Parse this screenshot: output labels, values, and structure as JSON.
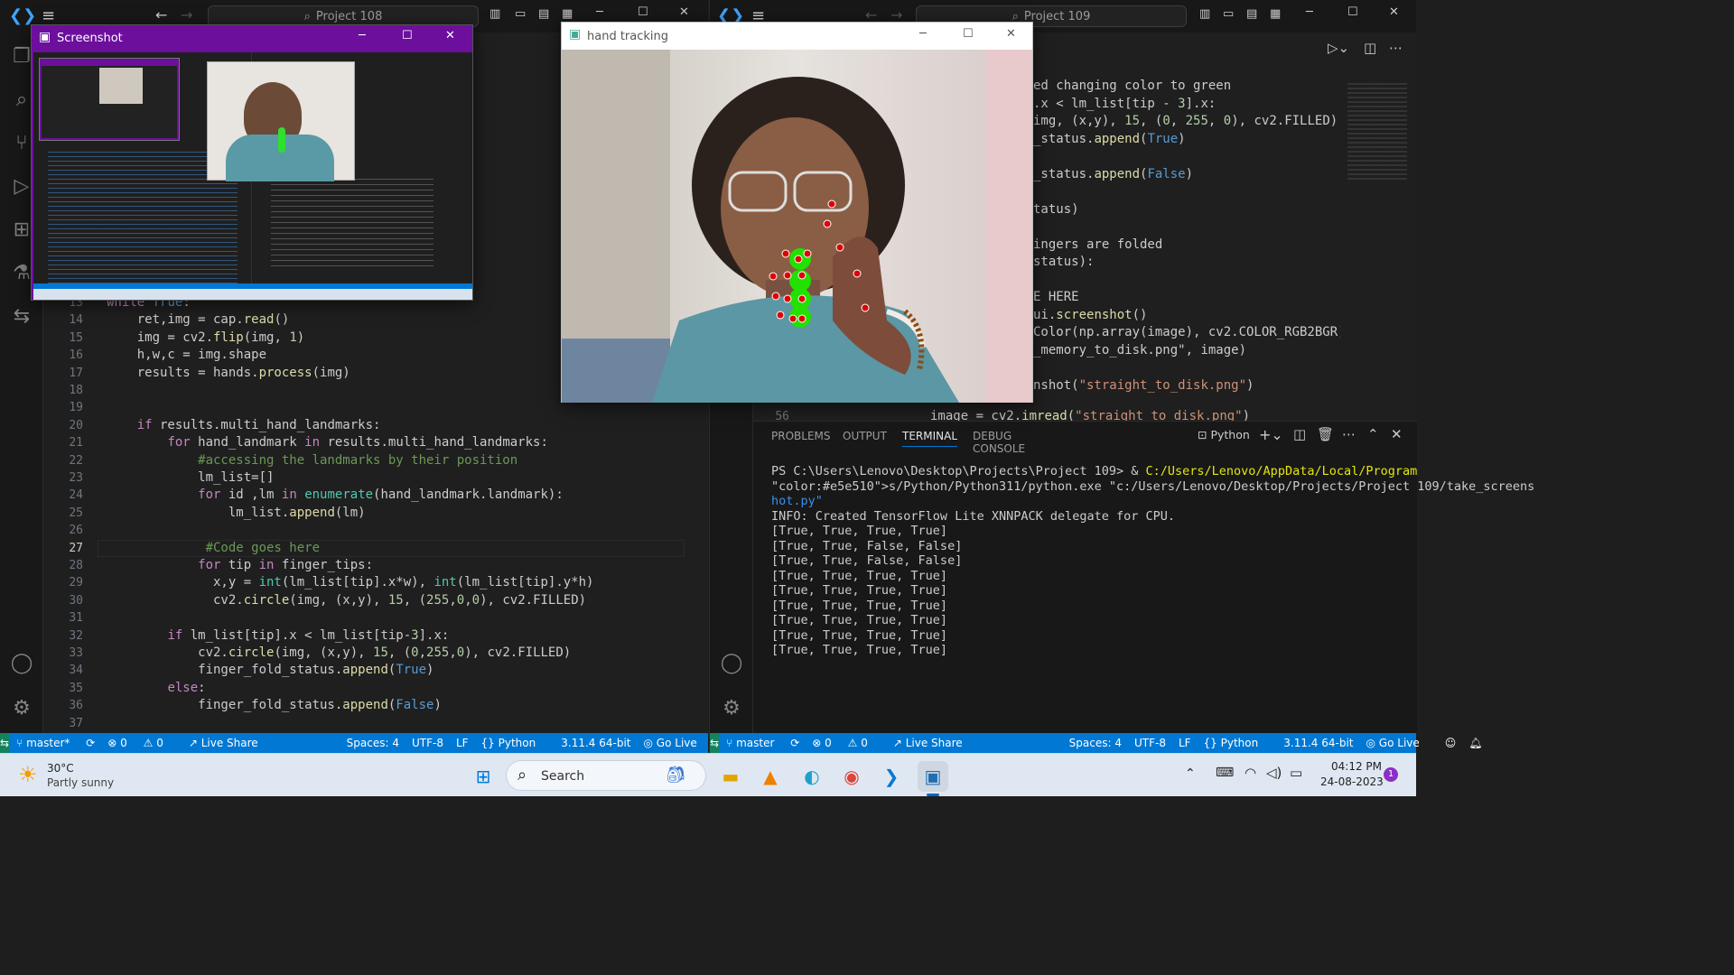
{
  "left_window": {
    "command_center": "Project 108",
    "code_lines": [
      {
        "n": "13",
        "t": "while True:"
      },
      {
        "n": "14",
        "t": "    ret,img = cap.read()"
      },
      {
        "n": "15",
        "t": "    img = cv2.flip(img, 1)"
      },
      {
        "n": "16",
        "t": "    h,w,c = img.shape"
      },
      {
        "n": "17",
        "t": "    results = hands.process(img)"
      },
      {
        "n": "18",
        "t": ""
      },
      {
        "n": "19",
        "t": ""
      },
      {
        "n": "20",
        "t": "    if results.multi_hand_landmarks:"
      },
      {
        "n": "21",
        "t": "        for hand_landmark in results.multi_hand_landmarks:"
      },
      {
        "n": "22",
        "t": "            #accessing the landmarks by their position"
      },
      {
        "n": "23",
        "t": "            lm_list=[]"
      },
      {
        "n": "24",
        "t": "            for id ,lm in enumerate(hand_landmark.landmark):"
      },
      {
        "n": "25",
        "t": "                lm_list.append(lm)"
      },
      {
        "n": "26",
        "t": ""
      },
      {
        "n": "27",
        "t": "             #Code goes here"
      },
      {
        "n": "28",
        "t": "            for tip in finger_tips:"
      },
      {
        "n": "29",
        "t": "              x,y = int(lm_list[tip].x*w), int(lm_list[tip].y*h)"
      },
      {
        "n": "30",
        "t": "              cv2.circle(img, (x,y), 15, (255,0,0), cv2.FILLED)"
      },
      {
        "n": "31",
        "t": ""
      },
      {
        "n": "32",
        "t": "        if lm_list[tip].x < lm_list[tip-3].x:"
      },
      {
        "n": "33",
        "t": "            cv2.circle(img, (x,y), 15, (0,255,0), cv2.FILLED)"
      },
      {
        "n": "34",
        "t": "            finger_fold_status.append(True)"
      },
      {
        "n": "35",
        "t": "        else:"
      },
      {
        "n": "36",
        "t": "            finger_fold_status.append(False)"
      },
      {
        "n": "37",
        "t": ""
      }
    ],
    "status": {
      "branch": "master*",
      "errors": "0",
      "warnings": "0",
      "live_share": "Live Share",
      "spaces": "Spaces: 4",
      "encoding": "UTF-8",
      "eol": "LF",
      "language": "Python",
      "version": "3.11.4 64-bit",
      "go_live": "Go Live"
    }
  },
  "right_window": {
    "command_center": "Project 109",
    "code_lines": [
      {
        "t": "ed changing color to green"
      },
      {
        "t": ".x < lm_list[tip - 3].x:"
      },
      {
        "t": "img, (x,y), 15, (0, 255, 0), cv2.FILLED)"
      },
      {
        "t": "_status.append(True)"
      },
      {
        "t": ""
      },
      {
        "t": "_status.append(False)"
      },
      {
        "t": ""
      },
      {
        "t": "tatus)"
      },
      {
        "t": ""
      },
      {
        "t": "ingers are folded"
      },
      {
        "t": "status):"
      },
      {
        "t": ""
      },
      {
        "t": "E HERE"
      },
      {
        "t": "ui.screenshot()"
      },
      {
        "t": "Color(np.array(image), cv2.COLOR_RGB2BGR)"
      },
      {
        "t": "_memory_to_disk.png\", image)"
      },
      {
        "t": ""
      },
      {
        "t": "nshot(\"straight_to_disk.png\")"
      }
    ],
    "partial_line": {
      "n": "56",
      "t": "image = cv2.imread(\"straight_to_disk.png\")"
    },
    "panel_tabs": [
      "PROBLEMS",
      "OUTPUT",
      "TERMINAL",
      "DEBUG CONSOLE"
    ],
    "terminal_profile": "Python",
    "terminal_lines": [
      "PS C:\\Users\\Lenovo\\Desktop\\Projects\\Project 109> & C:/Users/Lenovo/AppData/Local/Program",
      "s/Python/Python311/python.exe \"c:/Users/Lenovo/Desktop/Projects/Project 109/take_screens",
      "hot.py\"",
      "INFO: Created TensorFlow Lite XNNPACK delegate for CPU.",
      "[True, True, True, True]",
      "[True, True, False, False]",
      "[True, True, False, False]",
      "[True, True, True, True]",
      "[True, True, True, True]",
      "[True, True, True, True]",
      "[True, True, True, True]",
      "[True, True, True, True]",
      "[True, True, True, True]"
    ],
    "status": {
      "branch": "master",
      "errors": "0",
      "warnings": "0",
      "live_share": "Live Share",
      "spaces": "Spaces: 4",
      "encoding": "UTF-8",
      "eol": "LF",
      "language": "Python",
      "version": "3.11.4 64-bit",
      "go_live": "Go Live"
    }
  },
  "screenshot_window": {
    "title": "Screenshot"
  },
  "hand_window": {
    "title": "hand tracking"
  },
  "taskbar": {
    "weather_temp": "30°C",
    "weather_desc": "Partly sunny",
    "search_label": "Search",
    "time": "04:12 PM",
    "date": "24-08-2023",
    "notification_count": "1"
  },
  "colors": {
    "accent": "#0078d4",
    "screenshot_titlebar": "#6b0f9c",
    "landmark_red": "#e00000",
    "tip_green": "#22e000"
  }
}
